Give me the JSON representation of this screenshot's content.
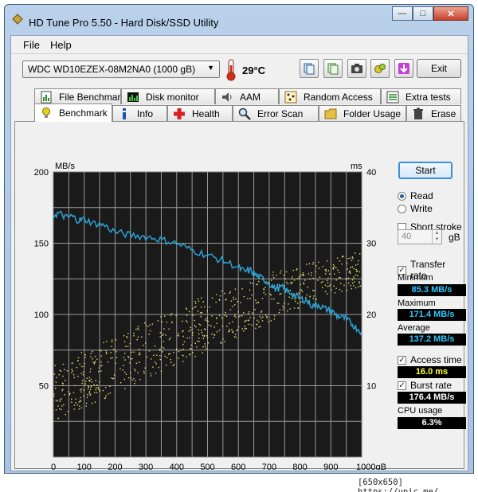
{
  "window": {
    "title": "HD Tune Pro 5.50 - Hard Disk/SSD Utility"
  },
  "menu": {
    "file": "File",
    "help": "Help"
  },
  "toolbar": {
    "drive": "WDC WD10EZEX-08M2NA0 (1000 gB)",
    "temperature": "29°C",
    "exit_label": "Exit"
  },
  "tabs_top": [
    "File Benchmark",
    "Disk monitor",
    "AAM",
    "Random Access",
    "Extra tests"
  ],
  "tabs_bottom": [
    "Benchmark",
    "Info",
    "Health",
    "Error Scan",
    "Folder Usage",
    "Erase"
  ],
  "controls": {
    "start_label": "Start",
    "read_label": "Read",
    "write_label": "Write",
    "short_stroke_label": "Short stroke",
    "short_stroke_value": "40",
    "short_stroke_unit": "gB",
    "transfer_rate_label": "Transfer rate",
    "minimum_label": "Minimum",
    "minimum_value": "85.3 MB/s",
    "maximum_label": "Maximum",
    "maximum_value": "171.4 MB/s",
    "average_label": "Average",
    "average_value": "137.2 MB/s",
    "access_time_label": "Access time",
    "access_time_value": "16.0 ms",
    "burst_rate_label": "Burst rate",
    "burst_rate_value": "176.4 MB/s",
    "cpu_usage_label": "CPU usage",
    "cpu_usage_value": "6.3%"
  },
  "footer": {
    "text": "[650x650] https://upic.me/"
  },
  "colors": {
    "plot_bg": "#1a1a1a",
    "grid": "#9a9a9a",
    "transfer_line": "#2ba3d6",
    "access_dots": "#e0e070",
    "value_blue": "#30c8ff",
    "value_yellow": "#ffff33"
  },
  "chart_data": {
    "type": "line",
    "left_axis_label": "MB/s",
    "right_axis_label": "ms",
    "xlim": [
      0,
      1000
    ],
    "ylim_left": [
      0,
      200
    ],
    "ylim_right": [
      0,
      40
    ],
    "x_ticks": [
      "0",
      "100",
      "200",
      "300",
      "400",
      "500",
      "600",
      "700",
      "800",
      "900",
      "1000gB"
    ],
    "y_left_ticks": [
      "50",
      "100",
      "150",
      "200"
    ],
    "y_right_ticks": [
      "10",
      "20",
      "30",
      "40"
    ],
    "grid": true,
    "series": [
      {
        "kind": "transfer_rate",
        "x": [
          0,
          20,
          40,
          60,
          80,
          100,
          130,
          160,
          200,
          240,
          280,
          320,
          360,
          400,
          440,
          480,
          520,
          560,
          600,
          620,
          640,
          660,
          680,
          700,
          720,
          740,
          760,
          780,
          800,
          820,
          840,
          860,
          880,
          900,
          920,
          940,
          960,
          980,
          1000
        ],
        "y": [
          170,
          171,
          168,
          169,
          166,
          167,
          164,
          163,
          158,
          156,
          155,
          154,
          152,
          150,
          146,
          143,
          140,
          137,
          133,
          130,
          131,
          127,
          125,
          122,
          118,
          119,
          116,
          114,
          111,
          110,
          106,
          107,
          104,
          103,
          99,
          98,
          95,
          91,
          88
        ]
      },
      {
        "kind": "access_time",
        "band_low_ms": [
          5,
          7,
          9,
          11,
          13,
          15,
          17,
          19,
          21,
          23,
          24
        ],
        "band_high_ms": [
          13,
          15,
          17,
          19,
          21,
          23,
          24,
          26,
          27,
          28,
          29
        ],
        "band_x": [
          0,
          100,
          200,
          300,
          400,
          500,
          600,
          700,
          800,
          900,
          1000
        ]
      }
    ],
    "legend": "none"
  }
}
